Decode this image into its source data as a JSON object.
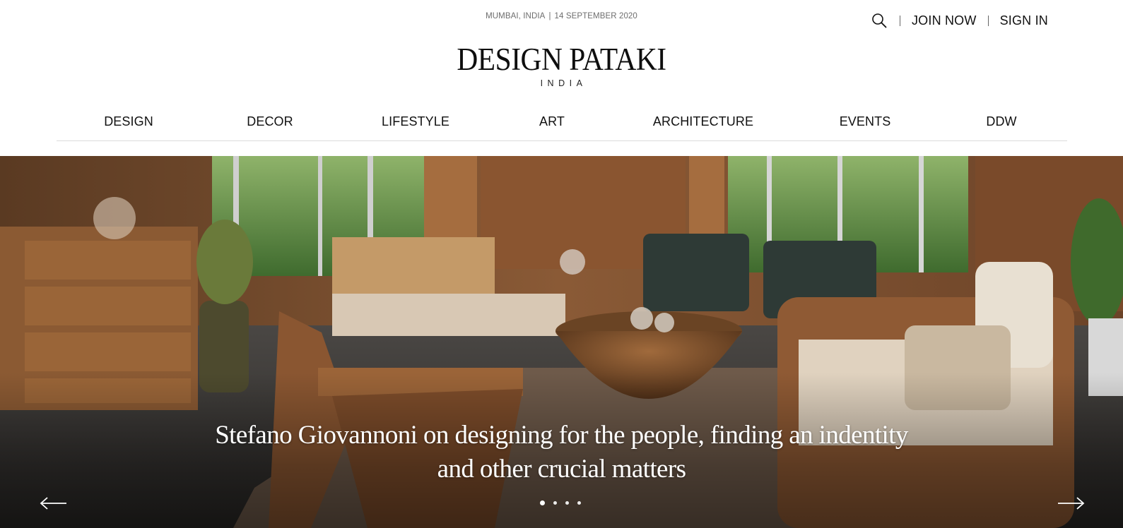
{
  "header": {
    "location": "MUMBAI, INDIA",
    "separator": "|",
    "date": "14 SEPTEMBER 2020",
    "search_icon": "search-icon",
    "join_label": "JOIN NOW",
    "signin_label": "SIGN IN"
  },
  "logo": {
    "brand": "DESIGN PATAKI",
    "sub": "INDIA"
  },
  "nav": {
    "items": [
      {
        "label": "DESIGN"
      },
      {
        "label": "DECOR"
      },
      {
        "label": "LIFESTYLE"
      },
      {
        "label": "ART"
      },
      {
        "label": "ARCHITECTURE"
      },
      {
        "label": "EVENTS"
      },
      {
        "label": "DDW"
      }
    ]
  },
  "hero": {
    "headline_line1": "Stefano Giovannoni on designing for the people, finding an indentity",
    "headline_line2": "and other crucial matters",
    "prev_icon": "arrow-left-icon",
    "next_icon": "arrow-right-icon",
    "active_slide": 1,
    "slide_count": 4
  },
  "colors": {
    "text": "#111111",
    "muted": "#6d6d6d",
    "divider": "#dcdcdc",
    "hero_text": "#ffffff"
  }
}
